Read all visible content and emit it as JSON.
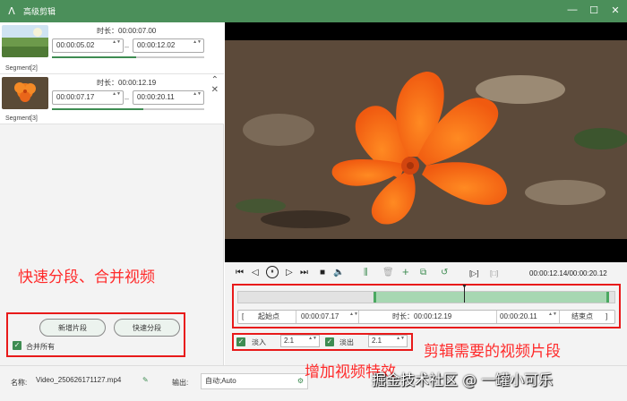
{
  "window": {
    "title": "高级剪辑",
    "logo": "ⴷ",
    "minimize": "—",
    "maximize": "☐",
    "close": "✕",
    "title_color": "#4b8f5a"
  },
  "segments": [
    {
      "label": "Segment[2]",
      "duration": "时长：00:00:07.00",
      "start": "00:00:05.02",
      "end": "00:00:12.02",
      "progress_fraction": 0.55
    },
    {
      "label": "Segment[3]",
      "duration": "时长：00:00:12.19",
      "start": "00:00:07.17",
      "end": "00:00:20.11",
      "progress_fraction": 0.6,
      "up_icon": "⌃",
      "close_icon": "✕"
    }
  ],
  "annotations": {
    "quick_split_merge": "快速分段、合并视频",
    "cut_needed": "剪辑需要的视频片段",
    "add_effect": "增加视频特效"
  },
  "left_actions": {
    "add_segment": "新增片段",
    "quick_split": "快速分段",
    "merge_all": "合并所有",
    "check": "✓"
  },
  "player": {
    "current_time": "00:00:12.14/00:00:20.12",
    "icons": {
      "prev": "⏮",
      "step_back": "◁",
      "pause": "⏸",
      "step_fwd": "▷",
      "next": "⏭",
      "stop": "■",
      "volume": "🔈",
      "split": "⫼",
      "delete": "🗑",
      "add": "+",
      "copy": "⧉",
      "reset": "↺",
      "mark_in": "[▷]",
      "mark_out": "[□]",
      "playhead": "▼"
    }
  },
  "trim": {
    "start_btn": "起始点",
    "start_time": "00:00:07.17",
    "duration": "时长：00:00:12.19",
    "end_time": "00:00:20.11",
    "end_btn": "结束点",
    "bracket_left": "[",
    "bracket_right": "]",
    "spin": "▲▼",
    "selection_start_fraction": 0.36,
    "selection_end_fraction": 1.0,
    "playhead_fraction": 0.6
  },
  "effects": {
    "fade_in_label": "淡入",
    "fade_in_value": "2.1",
    "fade_out_label": "淡出",
    "fade_out_value": "2.1"
  },
  "bottom": {
    "name_label": "名称:",
    "name_value": "Video_250626171127.mp4",
    "edit_icon": "✎",
    "output_label": "输出:",
    "output_value": "自动;Auto",
    "gear_icon": "⚙"
  },
  "watermark": "掘金技术社区 @ 一罐小可乐"
}
